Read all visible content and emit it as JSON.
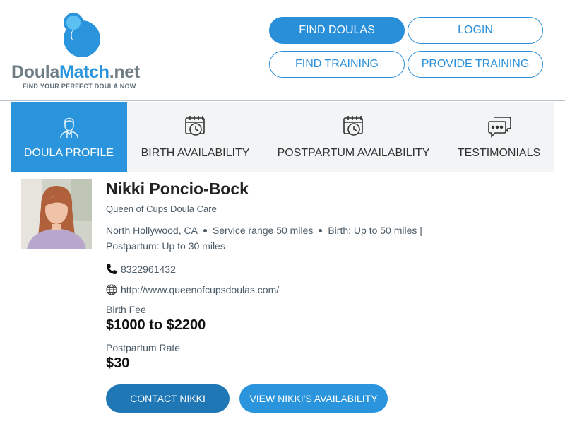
{
  "logo": {
    "part1": "Doula",
    "part2": "Match",
    "part3": ".net",
    "tagline": "FIND YOUR PERFECT DOULA NOW",
    "colors": {
      "blue": "#2a95dc",
      "light_blue": "#5cc0f2",
      "gray": "#6f7d87"
    }
  },
  "nav": {
    "find_doulas": "FIND DOULAS",
    "login": "LOGIN",
    "find_training": "FIND TRAINING",
    "provide_training": "PROVIDE TRAINING"
  },
  "tabs": [
    {
      "label": "DOULA PROFILE",
      "icon": "person-icon",
      "active": true
    },
    {
      "label": "BIRTH AVAILABILITY",
      "icon": "calendar-clock-icon",
      "active": false
    },
    {
      "label": "POSTPARTUM AVAILABILITY",
      "icon": "calendar-clock-icon",
      "active": false
    },
    {
      "label": "TESTIMONIALS",
      "icon": "chat-bubbles-icon",
      "active": false
    }
  ],
  "profile": {
    "name": "Nikki Poncio-Bock",
    "business": "Queen of Cups Doula Care",
    "location": "North Hollywood, CA",
    "service_range": "Service range 50 miles",
    "birth_range": "Birth: Up to 50 miles |",
    "postpartum_range": "Postpartum: Up to 30 miles",
    "phone": "8322961432",
    "website": "http://www.queenofcupsdoulas.com/",
    "birth_fee_label": "Birth Fee",
    "birth_fee": "$1000 to $2200",
    "postpartum_rate_label": "Postpartum Rate",
    "postpartum_rate": "$30"
  },
  "actions": {
    "contact": "CONTACT NIKKI",
    "availability": "VIEW NIKKI'S AVAILABILITY"
  },
  "colors": {
    "accent": "#2a95dc",
    "dark_accent": "#2077b5"
  }
}
